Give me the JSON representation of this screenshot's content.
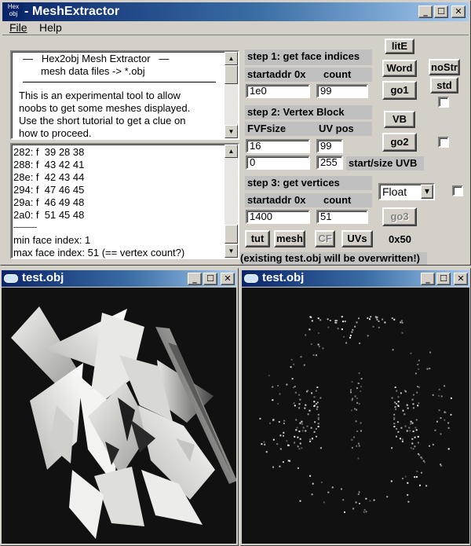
{
  "main_window": {
    "title": "MeshExtractor",
    "logo_top": "Hex",
    "logo_bottom": "obj",
    "menu": [
      "File",
      "Help"
    ],
    "info": {
      "heading": "—   Hex2obj Mesh Extractor   —",
      "subheading": "mesh data files -> *.obj",
      "body": [
        "This is an experimental tool to allow",
        "noobs to get some meshes displayed.",
        "Use the short tutorial to get a clue on",
        "how to proceed."
      ]
    },
    "log": {
      "lines": [
        "282: f  39 28 38",
        "288: f  43 42 41",
        "28e: f  42 43 44",
        "294: f  47 46 45",
        "29a: f  46 49 48",
        "2a0: f  51 45 48",
        "———",
        "min face index: 1",
        "max face index: 51 (== vertex count?)"
      ]
    },
    "step1": {
      "title": "step 1: get face indices",
      "col1": "startaddr 0x",
      "col2": "count",
      "val1": "1e0",
      "val2": "99"
    },
    "step2": {
      "title": "step 2: Vertex Block",
      "col1": "FVFsize",
      "col2": "UV pos",
      "val1": "16",
      "val2": "99",
      "val3": "0",
      "val4": "255",
      "uvb_label": "start/size UVB"
    },
    "step3": {
      "title": "step 3: get vertices",
      "col1": "startaddr 0x",
      "col2": "count",
      "val1": "1400",
      "val2": "51"
    },
    "buttons": {
      "litE": "litE",
      "word": "Word",
      "nostr": "noStr",
      "std": "std",
      "go1": "go1",
      "vb": "VB",
      "go2": "go2",
      "go3": "go3",
      "tut": "tut",
      "mesh": "mesh",
      "cf": "CF",
      "uvs": "UVs"
    },
    "float_select": "Float",
    "size_readout": "0x50",
    "warning": "(existing test.obj will be overwritten!)"
  },
  "viewer_left": {
    "title": "test.obj"
  },
  "viewer_right": {
    "title": "test.obj"
  }
}
